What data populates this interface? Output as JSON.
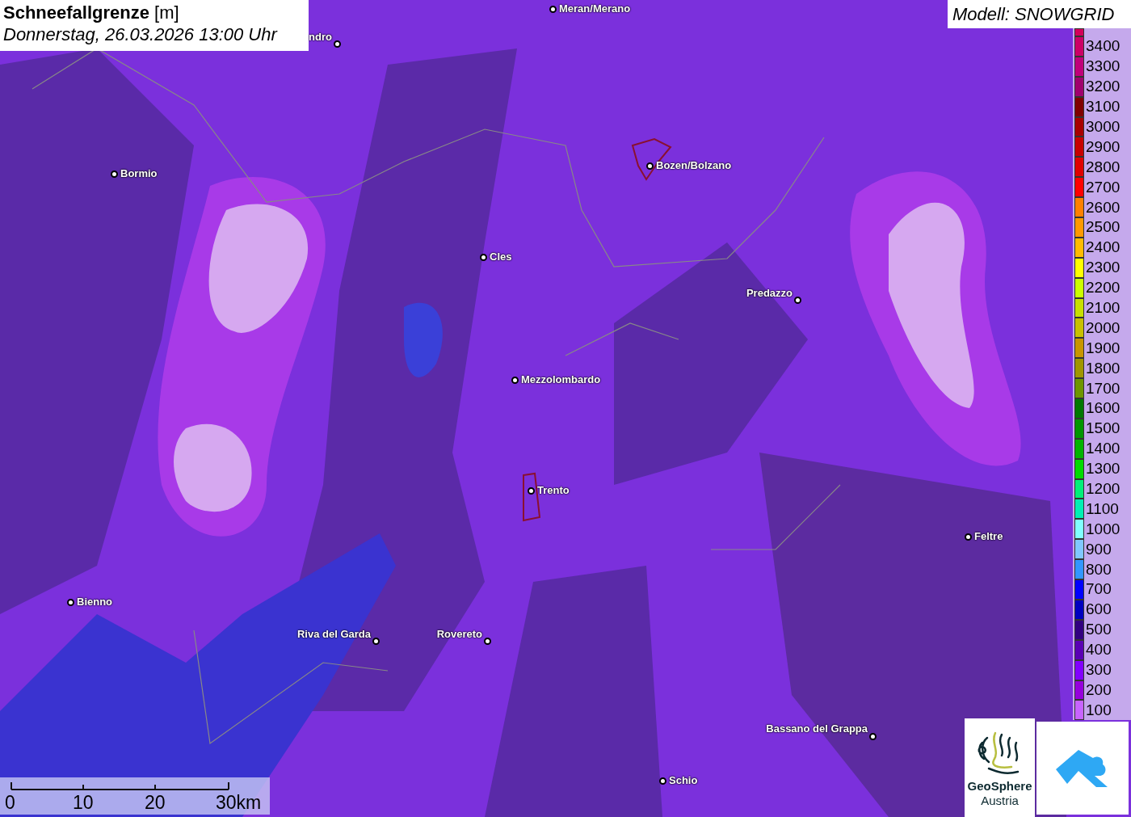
{
  "title": {
    "name": "Schneefallgrenze",
    "unit": "[m]",
    "date": "Donnerstag, 26.03.2026 13:00 Uhr"
  },
  "model": "Modell: SNOWGRID",
  "cities": [
    {
      "name": "Meran/Merano"
    },
    {
      "name": "ndro"
    },
    {
      "name": "Bormio"
    },
    {
      "name": "Bozen/Bolzano"
    },
    {
      "name": "Cles"
    },
    {
      "name": "Predazzo"
    },
    {
      "name": "Mezzolombardo"
    },
    {
      "name": "Trento"
    },
    {
      "name": "Feltre"
    },
    {
      "name": "Bienno"
    },
    {
      "name": "Riva del Garda"
    },
    {
      "name": "Rovereto"
    },
    {
      "name": "Bassano del Grappa"
    },
    {
      "name": "Schio"
    }
  ],
  "legend": [
    {
      "label": "3400",
      "color": "#cc0066"
    },
    {
      "label": "3300",
      "color": "#c0007a"
    },
    {
      "label": "3200",
      "color": "#a0006e"
    },
    {
      "label": "3100",
      "color": "#800000"
    },
    {
      "label": "3000",
      "color": "#a80000"
    },
    {
      "label": "2900",
      "color": "#c80000"
    },
    {
      "label": "2800",
      "color": "#e00000"
    },
    {
      "label": "2700",
      "color": "#ff0000"
    },
    {
      "label": "2600",
      "color": "#ff8000"
    },
    {
      "label": "2500",
      "color": "#ff9900"
    },
    {
      "label": "2400",
      "color": "#ffbb00"
    },
    {
      "label": "2300",
      "color": "#ffff00"
    },
    {
      "label": "2200",
      "color": "#ccff00"
    },
    {
      "label": "2100",
      "color": "#c8e000"
    },
    {
      "label": "2000",
      "color": "#c8c000"
    },
    {
      "label": "1900",
      "color": "#c89600"
    },
    {
      "label": "1800",
      "color": "#a09600"
    },
    {
      "label": "1700",
      "color": "#6e9600"
    },
    {
      "label": "1600",
      "color": "#007800"
    },
    {
      "label": "1500",
      "color": "#009600"
    },
    {
      "label": "1400",
      "color": "#00b400"
    },
    {
      "label": "1300",
      "color": "#00dc00"
    },
    {
      "label": "1200",
      "color": "#00f07a"
    },
    {
      "label": "1100",
      "color": "#00f0b4"
    },
    {
      "label": "1000",
      "color": "#80ffff"
    },
    {
      "label": "900",
      "color": "#80c8ff"
    },
    {
      "label": "800",
      "color": "#3296ff"
    },
    {
      "label": "700",
      "color": "#0000ff"
    },
    {
      "label": "600",
      "color": "#0000c0"
    },
    {
      "label": "500",
      "color": "#320080"
    },
    {
      "label": "400",
      "color": "#5a00b4"
    },
    {
      "label": "300",
      "color": "#8200ff"
    },
    {
      "label": "200",
      "color": "#9600dc"
    },
    {
      "label": "100",
      "color": "#c864ff"
    }
  ],
  "scale": {
    "ticks": [
      "0",
      "10",
      "20",
      "30km"
    ]
  },
  "logo": {
    "line1": "GeoSphere",
    "line2": "Austria"
  }
}
